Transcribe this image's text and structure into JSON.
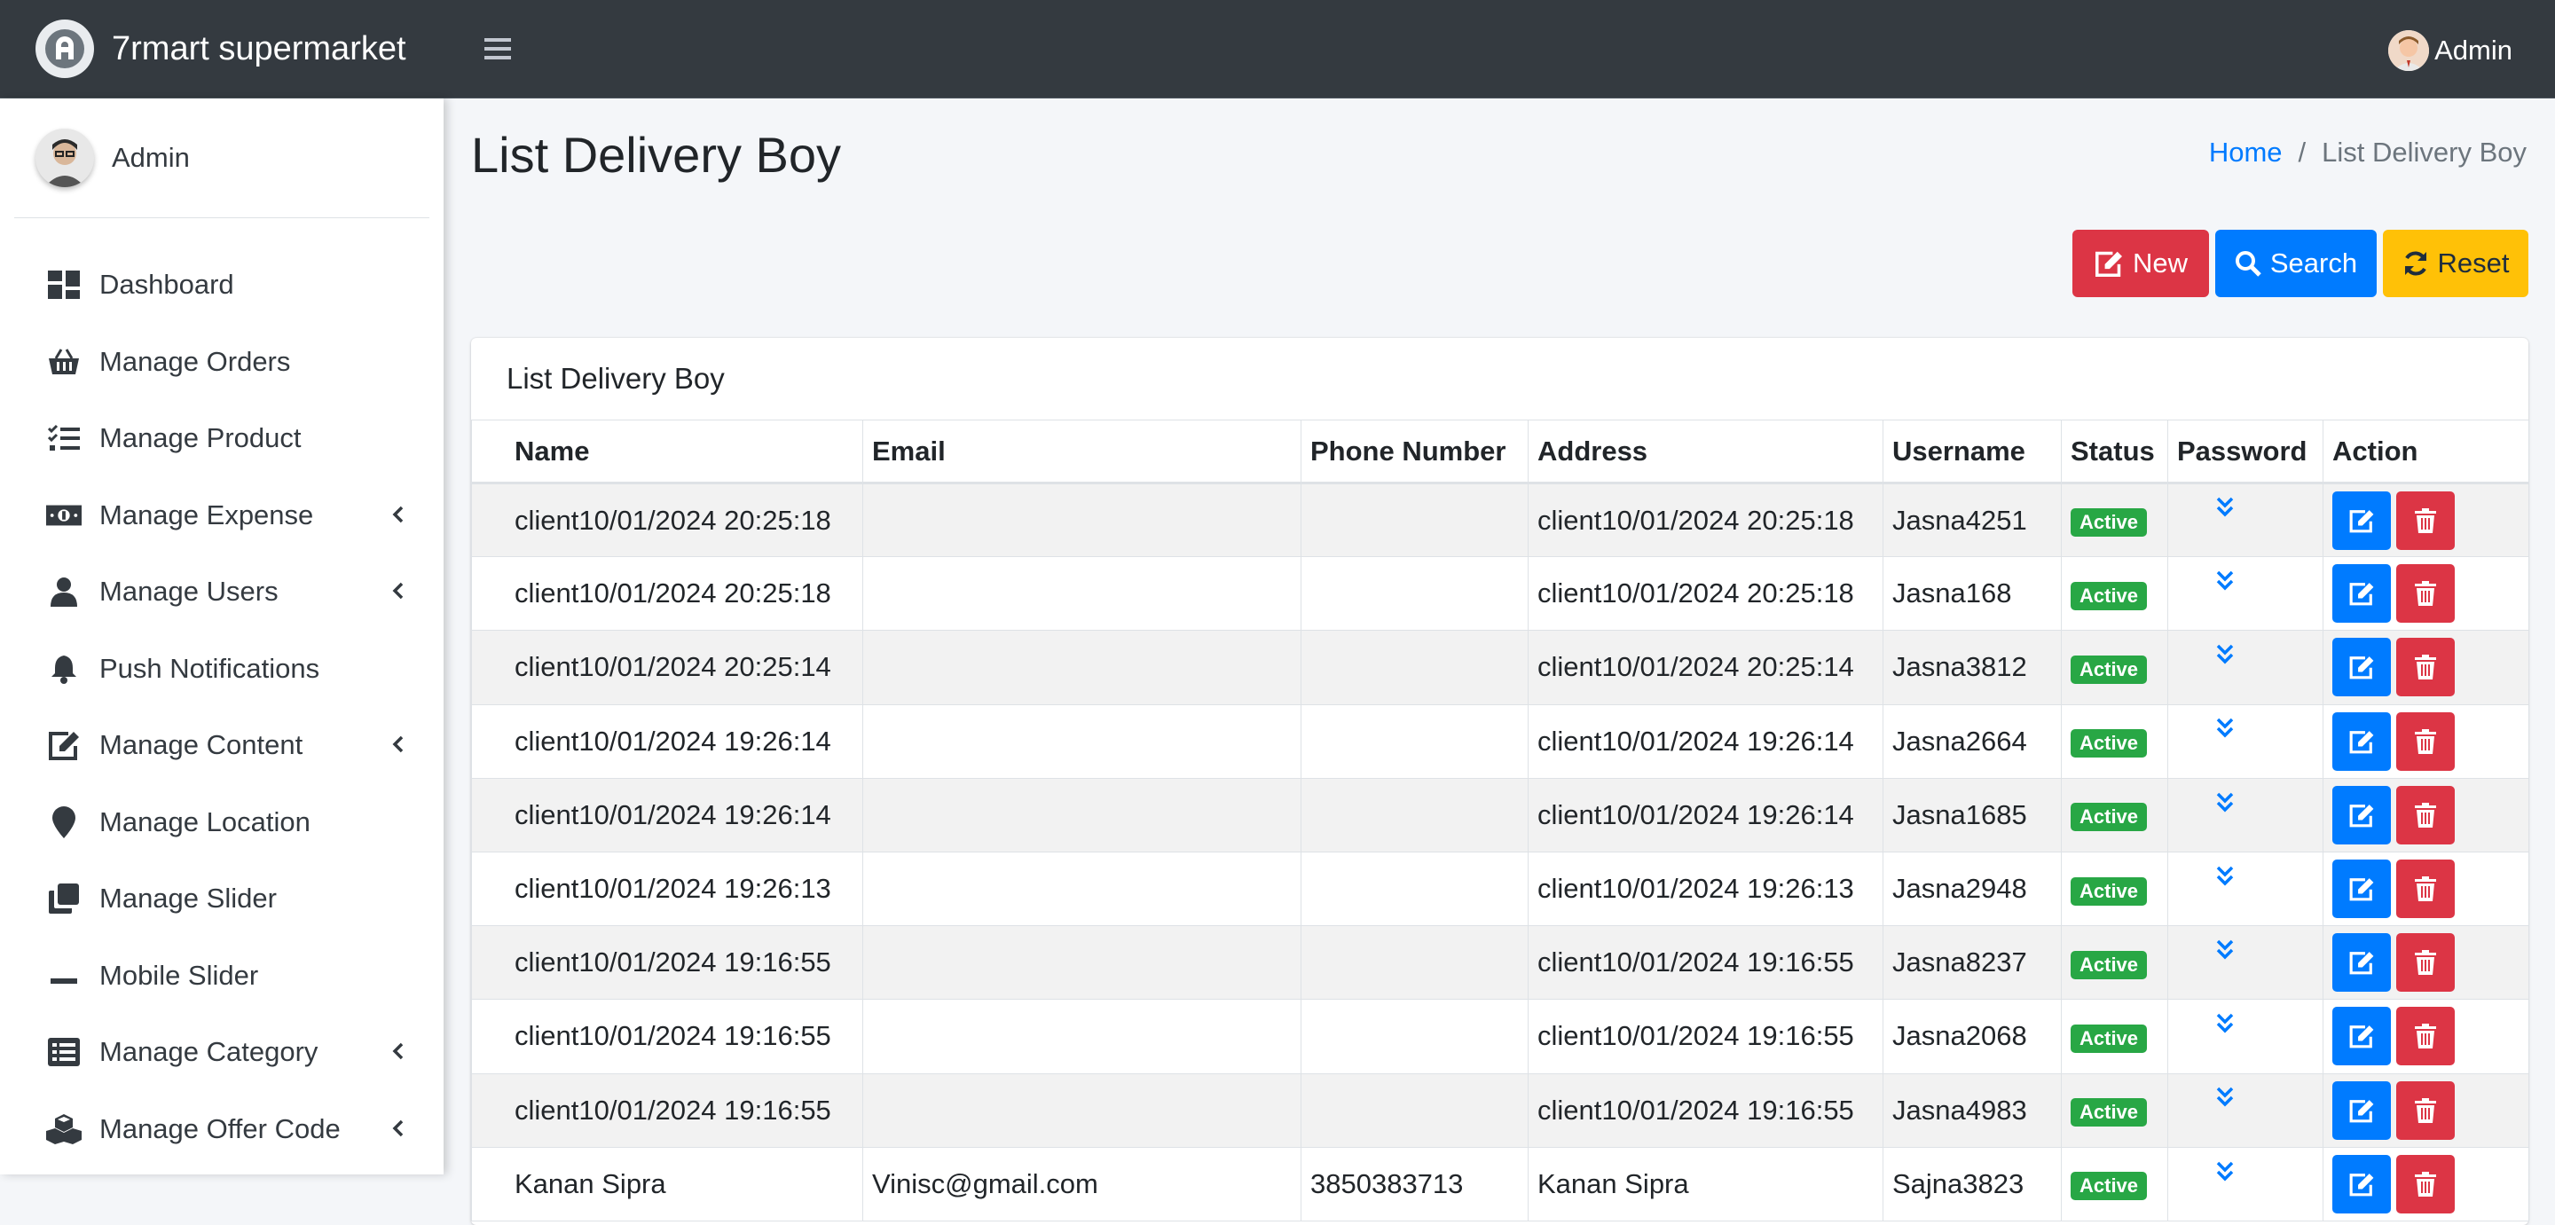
{
  "brand": {
    "name": "7rmart supermarket"
  },
  "user": {
    "name": "Admin"
  },
  "top_user": {
    "name": "Admin"
  },
  "sidebar": {
    "items": [
      {
        "label": "Dashboard",
        "icon": "dashboard-icon",
        "has_caret": false
      },
      {
        "label": "Manage Orders",
        "icon": "basket-icon",
        "has_caret": false
      },
      {
        "label": "Manage Product",
        "icon": "list-check-icon",
        "has_caret": false
      },
      {
        "label": "Manage Expense",
        "icon": "money-icon",
        "has_caret": true
      },
      {
        "label": "Manage Users",
        "icon": "user-icon",
        "has_caret": true
      },
      {
        "label": "Push Notifications",
        "icon": "bell-icon",
        "has_caret": false
      },
      {
        "label": "Manage Content",
        "icon": "edit-icon",
        "has_caret": true
      },
      {
        "label": "Manage Location",
        "icon": "map-marker-icon",
        "has_caret": false
      },
      {
        "label": "Manage Slider",
        "icon": "clone-icon",
        "has_caret": false
      },
      {
        "label": "Mobile Slider",
        "icon": "minus-icon",
        "has_caret": false
      },
      {
        "label": "Manage Category",
        "icon": "list-alt-icon",
        "has_caret": true
      },
      {
        "label": "Manage Offer Code",
        "icon": "cubes-icon",
        "has_caret": true
      }
    ]
  },
  "page": {
    "title": "List Delivery Boy"
  },
  "breadcrumb": {
    "home": "Home",
    "current": "List Delivery Boy"
  },
  "toolbar": {
    "new_label": "New",
    "search_label": "Search",
    "reset_label": "Reset"
  },
  "card": {
    "title": "List Delivery Boy"
  },
  "table": {
    "columns": [
      "Name",
      "Email",
      "Phone Number",
      "Address",
      "Username",
      "Status",
      "Password",
      "Action"
    ],
    "rows": [
      {
        "name": "client10/01/2024 20:25:18",
        "email": "",
        "phone": "",
        "address": "client10/01/2024 20:25:18",
        "username": "Jasna4251",
        "status": "Active"
      },
      {
        "name": "client10/01/2024 20:25:18",
        "email": "",
        "phone": "",
        "address": "client10/01/2024 20:25:18",
        "username": "Jasna168",
        "status": "Active"
      },
      {
        "name": "client10/01/2024 20:25:14",
        "email": "",
        "phone": "",
        "address": "client10/01/2024 20:25:14",
        "username": "Jasna3812",
        "status": "Active"
      },
      {
        "name": "client10/01/2024 19:26:14",
        "email": "",
        "phone": "",
        "address": "client10/01/2024 19:26:14",
        "username": "Jasna2664",
        "status": "Active"
      },
      {
        "name": "client10/01/2024 19:26:14",
        "email": "",
        "phone": "",
        "address": "client10/01/2024 19:26:14",
        "username": "Jasna1685",
        "status": "Active"
      },
      {
        "name": "client10/01/2024 19:26:13",
        "email": "",
        "phone": "",
        "address": "client10/01/2024 19:26:13",
        "username": "Jasna2948",
        "status": "Active"
      },
      {
        "name": "client10/01/2024 19:16:55",
        "email": "",
        "phone": "",
        "address": "client10/01/2024 19:16:55",
        "username": "Jasna8237",
        "status": "Active"
      },
      {
        "name": "client10/01/2024 19:16:55",
        "email": "",
        "phone": "",
        "address": "client10/01/2024 19:16:55",
        "username": "Jasna2068",
        "status": "Active"
      },
      {
        "name": "client10/01/2024 19:16:55",
        "email": "",
        "phone": "",
        "address": "client10/01/2024 19:16:55",
        "username": "Jasna4983",
        "status": "Active"
      },
      {
        "name": "Kanan Sipra",
        "email": "Vinisc@gmail.com",
        "phone": "3850383713",
        "address": "Kanan Sipra",
        "username": "Sajna3823",
        "status": "Active"
      }
    ]
  },
  "colors": {
    "brand_dark": "#343a40",
    "primary": "#007bff",
    "danger": "#dc3545",
    "warning": "#ffc107",
    "success": "#28a745"
  }
}
